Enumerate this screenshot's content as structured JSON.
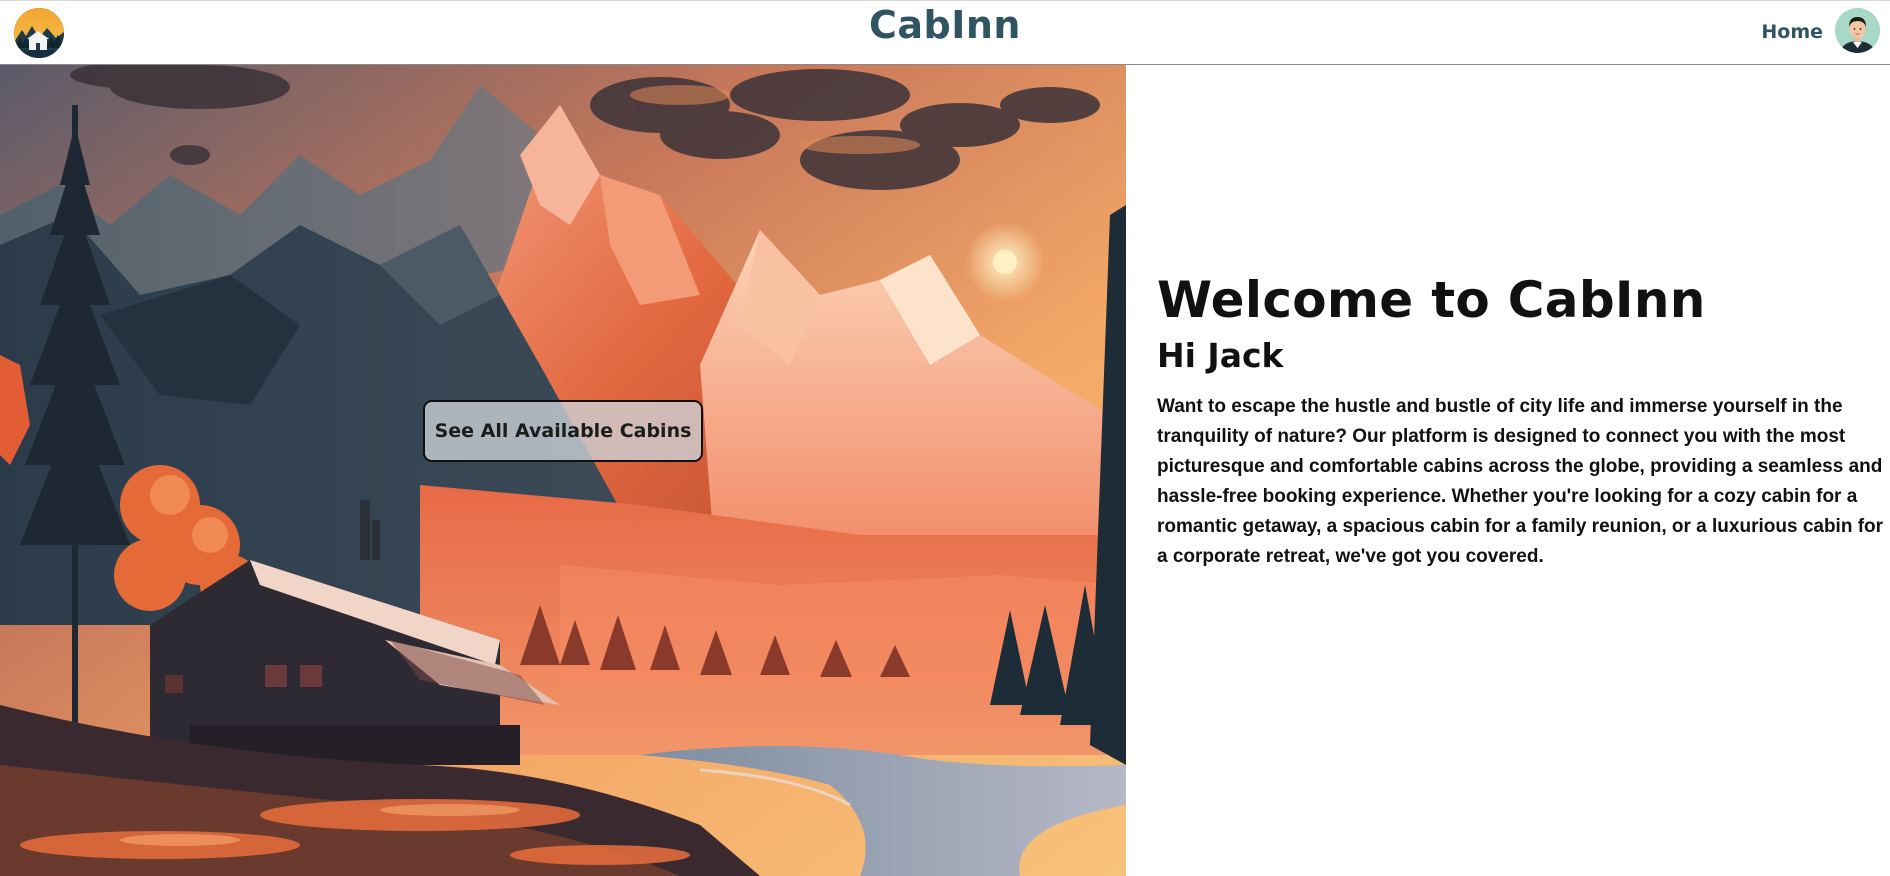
{
  "header": {
    "brand": "CabInn",
    "nav_home": "Home"
  },
  "hero": {
    "cta_label": "See All Available Cabins"
  },
  "intro": {
    "title": "Welcome to CabInn",
    "greeting": "Hi Jack",
    "description": "Want to escape the hustle and bustle of city life and immerse yourself in the tranquility of nature? Our platform is designed to connect you with the most picturesque and comfortable cabins across the globe, providing a seamless and hassle-free booking experience. Whether you're looking for a cozy cabin for a romantic getaway, a spacious cabin for a family reunion, or a luxurious cabin for a corporate retreat, we've got you covered."
  },
  "colors": {
    "brand": "#2f5562",
    "sky_warm": "#f7b25a",
    "mountain_glow": "#e8623b"
  },
  "icons": {
    "logo": "cabin-logo-icon",
    "avatar": "user-avatar-icon"
  }
}
